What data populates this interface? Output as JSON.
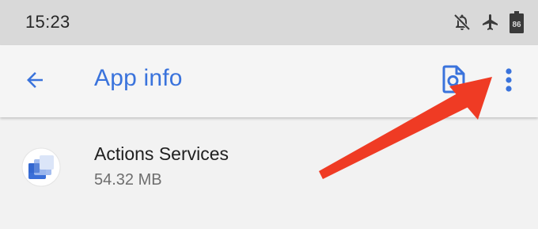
{
  "status_bar": {
    "time": "15:23",
    "icons": [
      "notifications-off-icon",
      "airplane-mode-icon",
      "battery-icon"
    ],
    "battery_level": "86"
  },
  "app_bar": {
    "title": "App info",
    "back_icon": "arrow-back-icon",
    "actions": [
      "document-search-icon",
      "more-vert-icon"
    ]
  },
  "app": {
    "name": "Actions Services",
    "size": "54.32 MB",
    "icon": "actions-services-app-icon"
  },
  "colors": {
    "accent": "#3a73dc",
    "status_bar_bg": "#d9d9d9",
    "app_bar_bg": "#f5f5f5",
    "annotation_arrow": "#ef3b24"
  }
}
